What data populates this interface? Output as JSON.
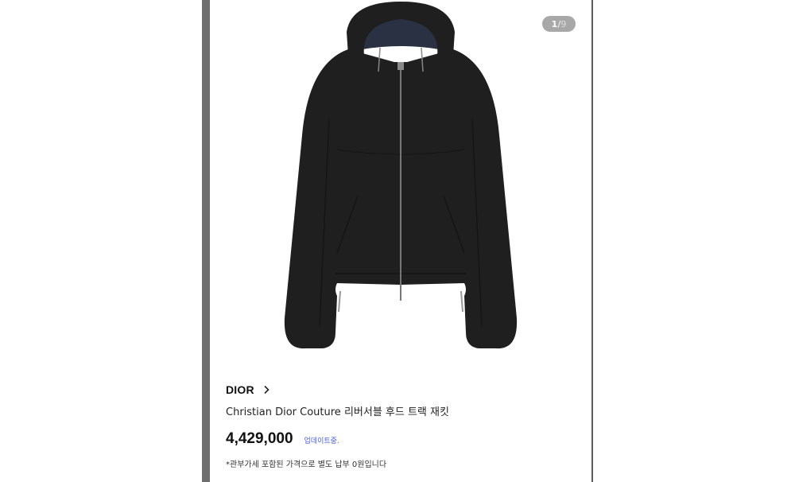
{
  "gallery": {
    "current": "1",
    "separator": "/",
    "total": "9"
  },
  "product": {
    "brand": "DIOR",
    "brand_link_icon": "chevron-right-icon",
    "name": "Christian Dior Couture 리버서블 후드 트랙 재킷",
    "price": "4,429,000",
    "price_status": "업데이트중.",
    "tax_note": "*관부가세 포함된 가격으로 별도 납부 0원입니다"
  },
  "colors": {
    "jacket": "#1f1f1f",
    "lining": "#2a3142",
    "accent_link": "#4a5fd6"
  }
}
